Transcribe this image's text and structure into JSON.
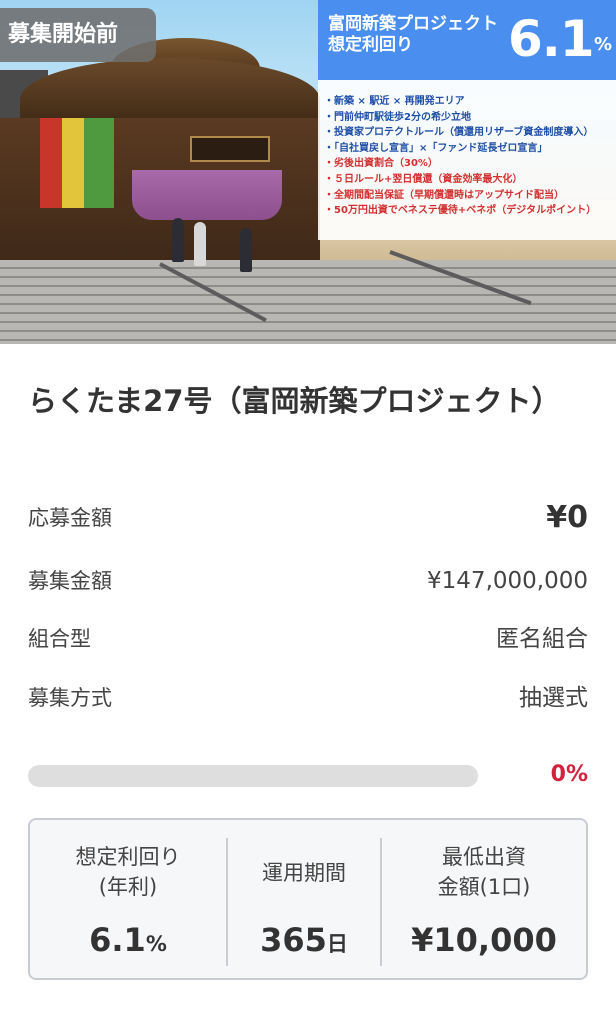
{
  "hero": {
    "status_tag": "募集開始前",
    "overlay_label_line1": "富岡新築プロジェクト",
    "overlay_label_line2": "想定利回り",
    "overlay_rate": "6.1",
    "overlay_rate_unit": "%",
    "features": [
      {
        "text": "・新築 × 駅近 × 再開発エリア",
        "color": "#1f4fa6"
      },
      {
        "text": "・門前仲町駅徒歩2分の希少立地",
        "color": "#1f4fa6"
      },
      {
        "text": "・投資家プロテクトルール（償還用リザーブ資金制度導入）",
        "color": "#1f4fa6"
      },
      {
        "text": "・「自社買戻し宣言」×「ファンド延長ゼロ宣言」",
        "color": "#1f4fa6"
      },
      {
        "text": "・劣後出資割合（30%）",
        "color": "#d23030"
      },
      {
        "text": "・５日ルール+翌日償還（資金効率最大化）",
        "color": "#d23030"
      },
      {
        "text": "・全期間配当保証（早期償還時はアップサイド配当）",
        "color": "#d23030"
      },
      {
        "text": "・50万円出資でベネステ優待+ベネポ（デジタルポイント）",
        "color": "#d23030"
      }
    ]
  },
  "fund": {
    "title": "らくたま27号（富岡新築プロジェクト）",
    "rows": [
      {
        "label": "応募金額",
        "value": "¥0"
      },
      {
        "label": "募集金額",
        "value": "¥147,000,000"
      },
      {
        "label": "組合型",
        "value": "匿名組合"
      },
      {
        "label": "募集方式",
        "value": "抽選式"
      }
    ],
    "progress_percent": 0,
    "progress_text": "0%"
  },
  "summary": {
    "yield_label_1": "想定利回り",
    "yield_label_2": "(年利)",
    "yield_value": "6.1",
    "yield_unit": "%",
    "period_label": "運用期間",
    "period_value": "365",
    "period_unit": "日",
    "min_label_1": "最低出資",
    "min_label_2": "金額(1口)",
    "min_value": "¥10,000"
  },
  "colors": {
    "accent_blue": "#4a8ff0",
    "accent_red": "#d1223e",
    "feature_blue": "#1f4fa6",
    "feature_red": "#d23030"
  }
}
